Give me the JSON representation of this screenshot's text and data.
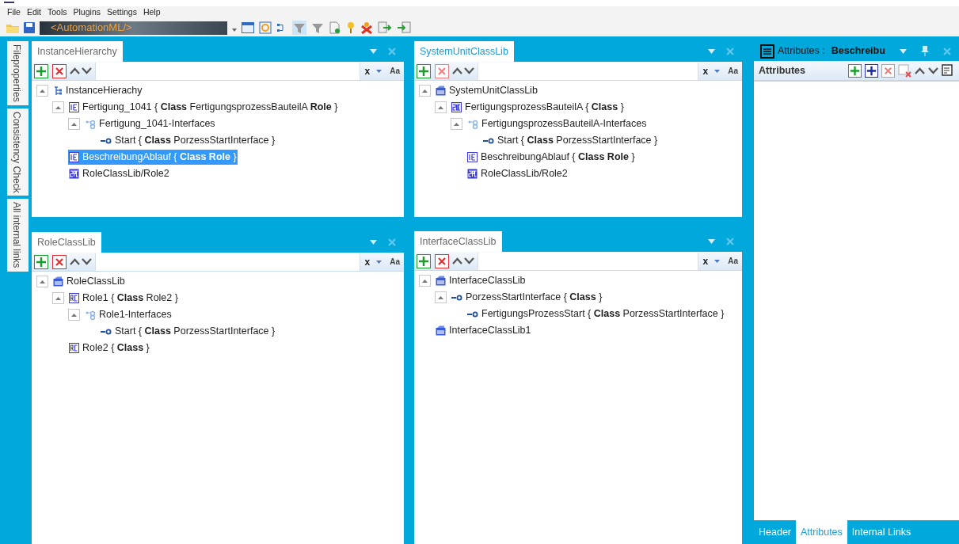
{
  "menu": [
    "File",
    "Edit",
    "Tools",
    "Plugins",
    "Settings",
    "Help"
  ],
  "toolbar": {
    "logo_text": "<AutomationML/>"
  },
  "side_tabs": [
    "Fileproperties",
    "Consistency Check",
    "All internal links"
  ],
  "left_panels": [
    {
      "title": "InstanceHierarchy",
      "active": false,
      "filter": {
        "clear": "x",
        "case": "Aa"
      },
      "tree": [
        {
          "text": "InstanceHierachy",
          "kind": "hierarchy",
          "expanded": true,
          "selected": false,
          "children": [
            {
              "text": "Fertigung_1041 { **Class** FertigungsprozessBauteilA **Role**  }",
              "kind": "element",
              "expanded": true,
              "selected": false,
              "children": [
                {
                  "text": "Fertigung_1041-Interfaces",
                  "kind": "interfaces",
                  "expanded": true,
                  "selected": false,
                  "children": [
                    {
                      "text": "Start { **Class** PorzessStartInterface }",
                      "kind": "interface",
                      "selected": false
                    }
                  ]
                }
              ]
            },
            {
              "text": "BeschreibungAblauf { **Class**  **Role**  }",
              "kind": "element",
              "selected": true
            },
            {
              "text": "RoleClassLib/Role2",
              "kind": "role-ref",
              "selected": false
            }
          ]
        }
      ]
    },
    {
      "title": "RoleClassLib",
      "active": false,
      "filter": {
        "clear": "x",
        "case": "Aa"
      },
      "tree": [
        {
          "text": "RoleClassLib",
          "kind": "library",
          "expanded": true,
          "selected": false,
          "children": [
            {
              "text": "Role1 { **Class** Role2 }",
              "kind": "role",
              "expanded": true,
              "selected": false,
              "children": [
                {
                  "text": "Role1-Interfaces",
                  "kind": "interfaces",
                  "expanded": true,
                  "selected": false,
                  "children": [
                    {
                      "text": "Start { **Class** PorzessStartInterface }",
                      "kind": "interface",
                      "selected": false
                    }
                  ]
                }
              ]
            },
            {
              "text": "Role2 { **Class**  }",
              "kind": "role",
              "selected": false
            }
          ]
        }
      ]
    }
  ],
  "center_panels": [
    {
      "title": "SystemUnitClassLib",
      "active": true,
      "filter": {
        "clear": "x",
        "case": "Aa"
      },
      "tree": [
        {
          "text": "SystemUnitClassLib",
          "kind": "library",
          "expanded": true,
          "selected": false,
          "children": [
            {
              "text": "FertigungsprozessBauteilA { **Class**  }",
              "kind": "system-unit",
              "expanded": true,
              "selected": false,
              "children": [
                {
                  "text": "FertigungsprozessBauteilA-Interfaces",
                  "kind": "interfaces",
                  "expanded": true,
                  "selected": false,
                  "children": [
                    {
                      "text": "Start { **Class** PorzessStartInterface }",
                      "kind": "interface",
                      "selected": false
                    }
                  ]
                },
                {
                  "text": "BeschreibungAblauf { **Class**  **Role**  }",
                  "kind": "element",
                  "selected": false
                },
                {
                  "text": "RoleClassLib/Role2",
                  "kind": "role-ref",
                  "selected": false
                }
              ]
            }
          ]
        }
      ]
    },
    {
      "title": "InterfaceClassLib",
      "active": false,
      "filter": {
        "clear": "x",
        "case": "Aa"
      },
      "tree": [
        {
          "text": "InterfaceClassLib",
          "kind": "library",
          "expanded": true,
          "selected": false,
          "children": [
            {
              "text": "PorzessStartInterface { **Class**  }",
              "kind": "interface",
              "expanded": true,
              "selected": false,
              "children": [
                {
                  "text": "FertigungsProzessStart { **Class** PorzessStartInterface }",
                  "kind": "interface",
                  "selected": false
                }
              ]
            }
          ]
        },
        {
          "text": "InterfaceClassLib1",
          "kind": "library",
          "selected": false
        }
      ]
    }
  ],
  "attributes": {
    "title": "Attributes :",
    "subject": "Beschreibu",
    "toolbar_label": "Attributes",
    "tabs": [
      {
        "label": "Header",
        "selected": false
      },
      {
        "label": "Attributes",
        "selected": true
      },
      {
        "label": "Internal Links",
        "selected": false
      }
    ]
  }
}
